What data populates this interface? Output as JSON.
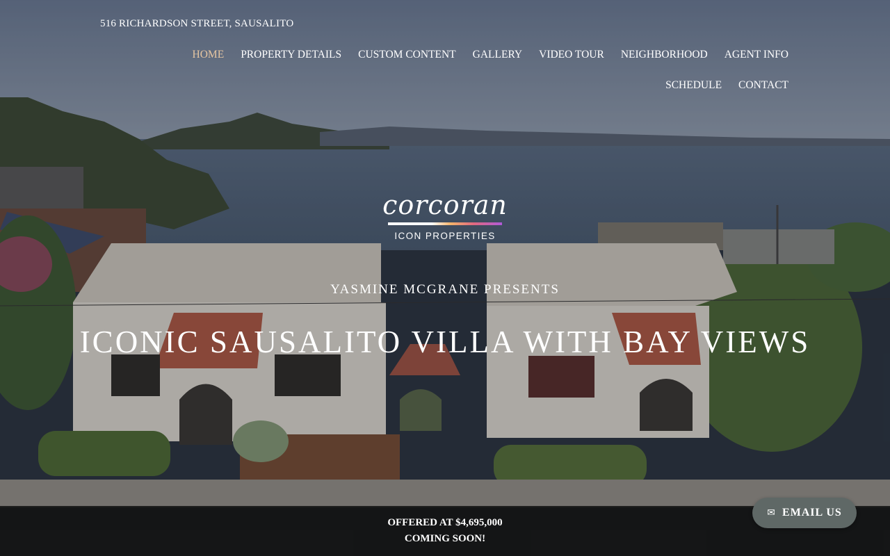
{
  "header": {
    "address": "516 RICHARDSON STREET, SAUSALITO",
    "nav": [
      {
        "label": "HOME",
        "active": true
      },
      {
        "label": "PROPERTY DETAILS"
      },
      {
        "label": "CUSTOM CONTENT"
      },
      {
        "label": "GALLERY"
      },
      {
        "label": "VIDEO TOUR"
      },
      {
        "label": "NEIGHBORHOOD"
      },
      {
        "label": "AGENT INFO"
      },
      {
        "label": "SCHEDULE"
      },
      {
        "label": "CONTACT"
      }
    ]
  },
  "logo": {
    "brand": "corcoran",
    "subtitle": "ICON PROPERTIES"
  },
  "hero": {
    "presents": "YASMINE MCGRANE PRESENTS",
    "headline": "ICONIC SAUSALITO VILLA WITH BAY VIEWS"
  },
  "offer": {
    "price_line": "OFFERED AT $4,695,000",
    "status_line": "COMING SOON!"
  },
  "email_button": {
    "label": "EMAIL US",
    "icon": "envelope-icon"
  },
  "colors": {
    "nav_active": "#e8c7a2",
    "email_button_bg": "#5f6866",
    "offer_bar_bg": "#121212"
  }
}
